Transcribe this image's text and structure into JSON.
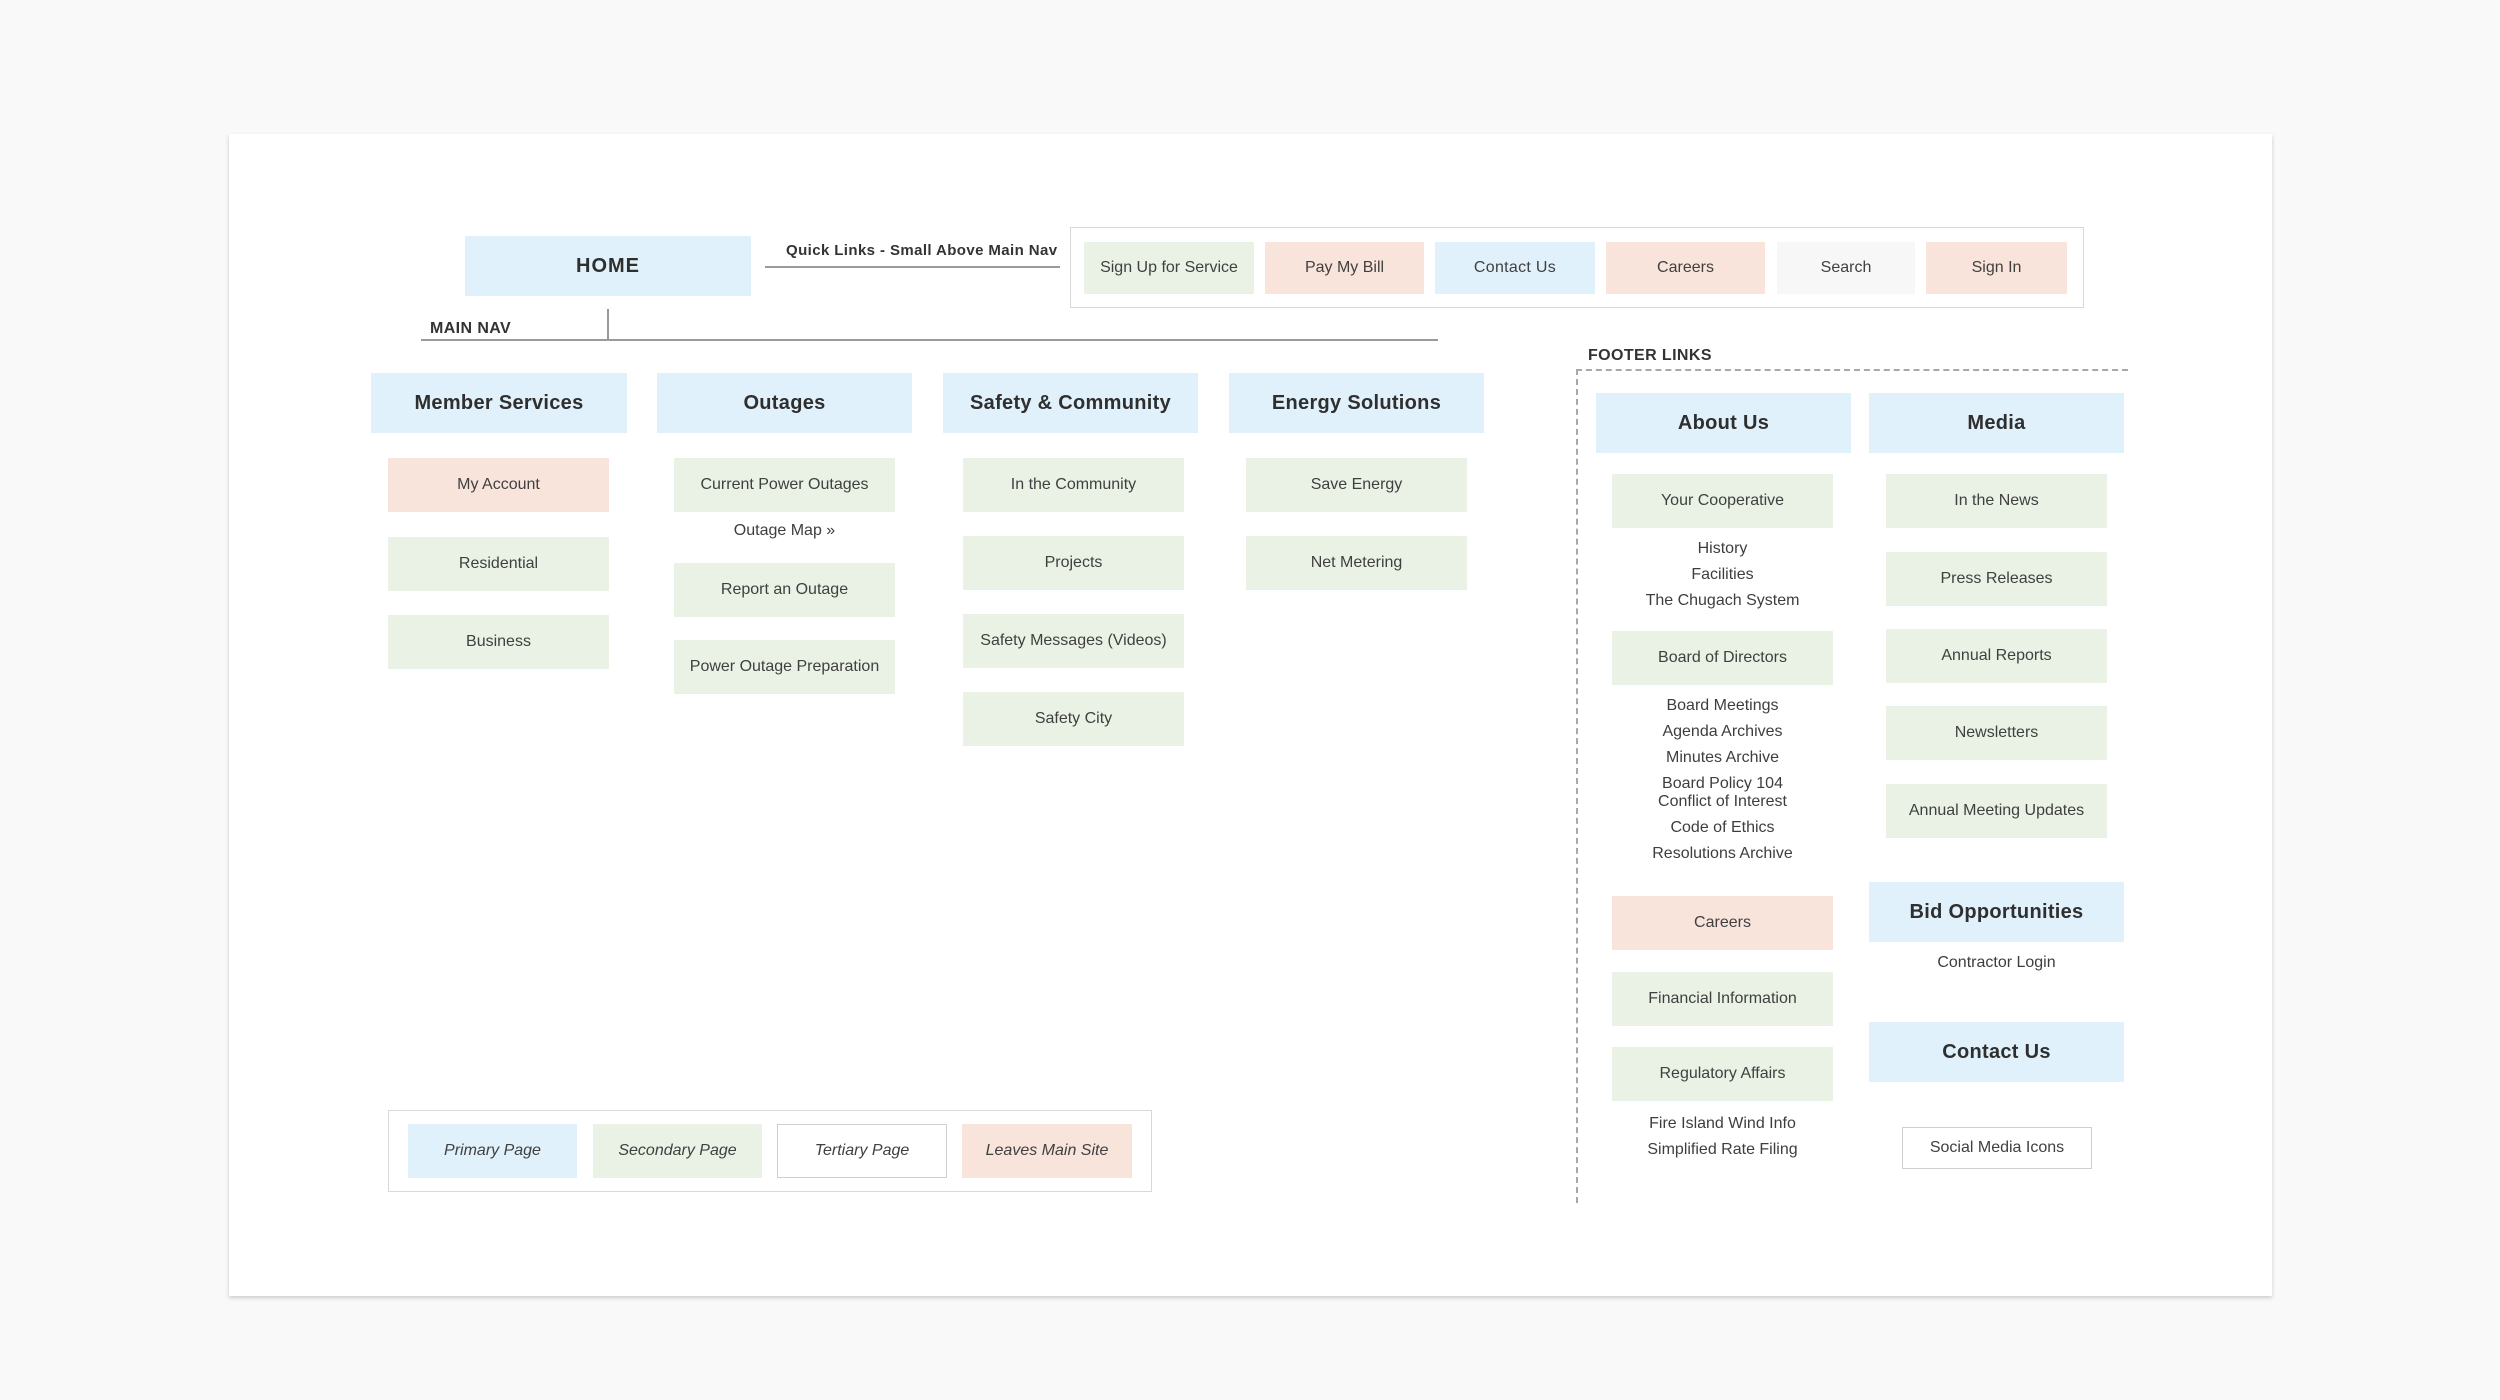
{
  "home": "HOME",
  "quick_links_label": "Quick Links - Small Above Main Nav",
  "main_nav_label": "MAIN NAV",
  "footer_links_label": "FOOTER LINKS",
  "quick_links": [
    "Sign Up for Service",
    "Pay My Bill",
    "Contact Us",
    "Careers",
    "Search",
    "Sign In"
  ],
  "member_services": {
    "title": "Member Services",
    "items": [
      "My Account",
      "Residential",
      "Business"
    ]
  },
  "outages": {
    "title": "Outages",
    "items": [
      "Current Power Outages",
      "Outage Map »",
      "Report an Outage",
      "Power Outage Preparation"
    ]
  },
  "safety": {
    "title": "Safety & Community",
    "items": [
      "In the Community",
      "Projects",
      "Safety Messages (Videos)",
      "Safety City"
    ]
  },
  "energy": {
    "title": "Energy Solutions",
    "items": [
      "Save Energy",
      "Net Metering"
    ]
  },
  "about": {
    "title": "About Us",
    "your_cooperative": "Your Cooperative",
    "coop_links": [
      "History",
      "Facilities",
      "The Chugach System"
    ],
    "board": "Board of Directors",
    "board_links": [
      "Board Meetings",
      "Agenda Archives",
      "Minutes Archive",
      "Board Policy 104",
      "Conflict of Interest",
      "Code of Ethics",
      "Resolutions Archive"
    ],
    "careers": "Careers",
    "financial": "Financial Information",
    "regulatory": "Regulatory Affairs",
    "regulatory_links": [
      "Fire Island Wind Info",
      "Simplified Rate Filing"
    ]
  },
  "media": {
    "title": "Media",
    "items": [
      "In the News",
      "Press Releases",
      "Annual Reports",
      "Newsletters",
      "Annual Meeting Updates"
    ]
  },
  "bid": {
    "title": "Bid Opportunities",
    "link": "Contractor Login"
  },
  "contact": {
    "title": "Contact Us",
    "social": "Social Media Icons"
  },
  "legend": [
    "Primary Page",
    "Secondary Page",
    "Tertiary Page",
    "Leaves Main Site"
  ],
  "colors": {
    "primary": "#e1f1fb",
    "secondary": "#e9f2e5",
    "leaves": "#f9e4dc",
    "tertiary": "#ffffff"
  }
}
